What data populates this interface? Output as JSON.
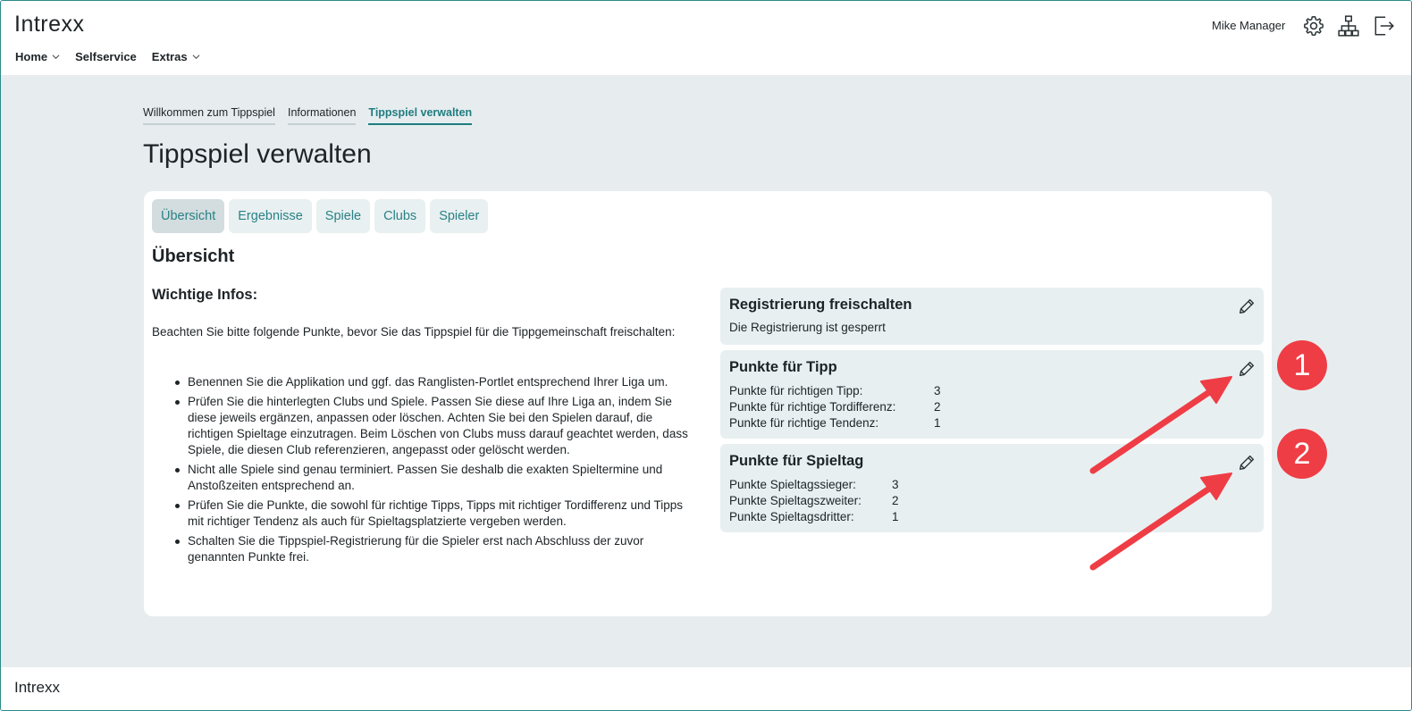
{
  "header": {
    "logo": "Intrexx",
    "nav": [
      {
        "label": "Home",
        "has_menu": true
      },
      {
        "label": "Selfservice",
        "has_menu": false
      },
      {
        "label": "Extras",
        "has_menu": true
      }
    ],
    "user": "Mike Manager",
    "icons": [
      "gear-icon",
      "sitemap-icon",
      "logout-icon"
    ]
  },
  "breadcrumb": [
    {
      "label": "Willkommen zum Tippspiel",
      "active": false
    },
    {
      "label": "Informationen",
      "active": false
    },
    {
      "label": "Tippspiel verwalten",
      "active": true
    }
  ],
  "page_title": "Tippspiel verwalten",
  "tabs": [
    {
      "label": "Übersicht",
      "active": true
    },
    {
      "label": "Ergebnisse",
      "active": false
    },
    {
      "label": "Spiele",
      "active": false
    },
    {
      "label": "Clubs",
      "active": false
    },
    {
      "label": "Spieler",
      "active": false
    }
  ],
  "section_title": "Übersicht",
  "info": {
    "title": "Wichtige Infos:",
    "intro": "Beachten Sie bitte folgende Punkte, bevor Sie das Tippspiel für die Tippgemeinschaft freischalten:",
    "items": [
      "Benennen Sie die Applikation und ggf. das Ranglisten-Portlet entsprechend Ihrer Liga um.",
      "Prüfen Sie die hinterlegten Clubs und Spiele. Passen Sie diese auf Ihre Liga an, indem Sie diese jeweils ergänzen, anpassen oder löschen. Achten Sie bei den Spielen darauf, die richtigen Spieltage einzutragen. Beim Löschen von Clubs muss darauf geachtet werden, dass Spiele, die diesen Club referenzieren, angepasst oder gelöscht werden.",
      "Nicht alle Spiele sind genau terminiert. Passen Sie deshalb die exakten Spieltermine und Anstoßzeiten entsprechend an.",
      "Prüfen Sie die Punkte, die sowohl für richtige Tipps, Tipps mit richtiger Tordifferenz und Tipps mit richtiger Tendenz als auch für Spieltagsplatzierte vergeben werden.",
      "Schalten Sie die Tippspiel-Registrierung für die Spieler erst nach Abschluss der zuvor genannten Punkte frei."
    ]
  },
  "panels": {
    "registration": {
      "title": "Registrierung freischalten",
      "text": "Die Registrierung ist gesperrt"
    },
    "tip_points": {
      "title": "Punkte für Tipp",
      "rows": [
        {
          "label": "Punkte für richtigen Tipp:",
          "value": "3"
        },
        {
          "label": "Punkte für richtige Tordifferenz:",
          "value": "2"
        },
        {
          "label": "Punkte für richtige Tendenz:",
          "value": "1"
        }
      ]
    },
    "matchday_points": {
      "title": "Punkte für Spieltag",
      "rows": [
        {
          "label": "Punkte Spieltagssieger:",
          "value": "3"
        },
        {
          "label": "Punkte Spieltagszweiter:",
          "value": "2"
        },
        {
          "label": "Punkte Spieltagsdritter:",
          "value": "1"
        }
      ]
    }
  },
  "annotations": {
    "badge1": "1",
    "badge2": "2",
    "color": "#ef3d45"
  },
  "footer": {
    "logo": "Intrexx"
  },
  "colors": {
    "accent": "#1f7d80",
    "background": "#e7edef",
    "panel": "#e8eff1",
    "annotation": "#ef3d45"
  }
}
